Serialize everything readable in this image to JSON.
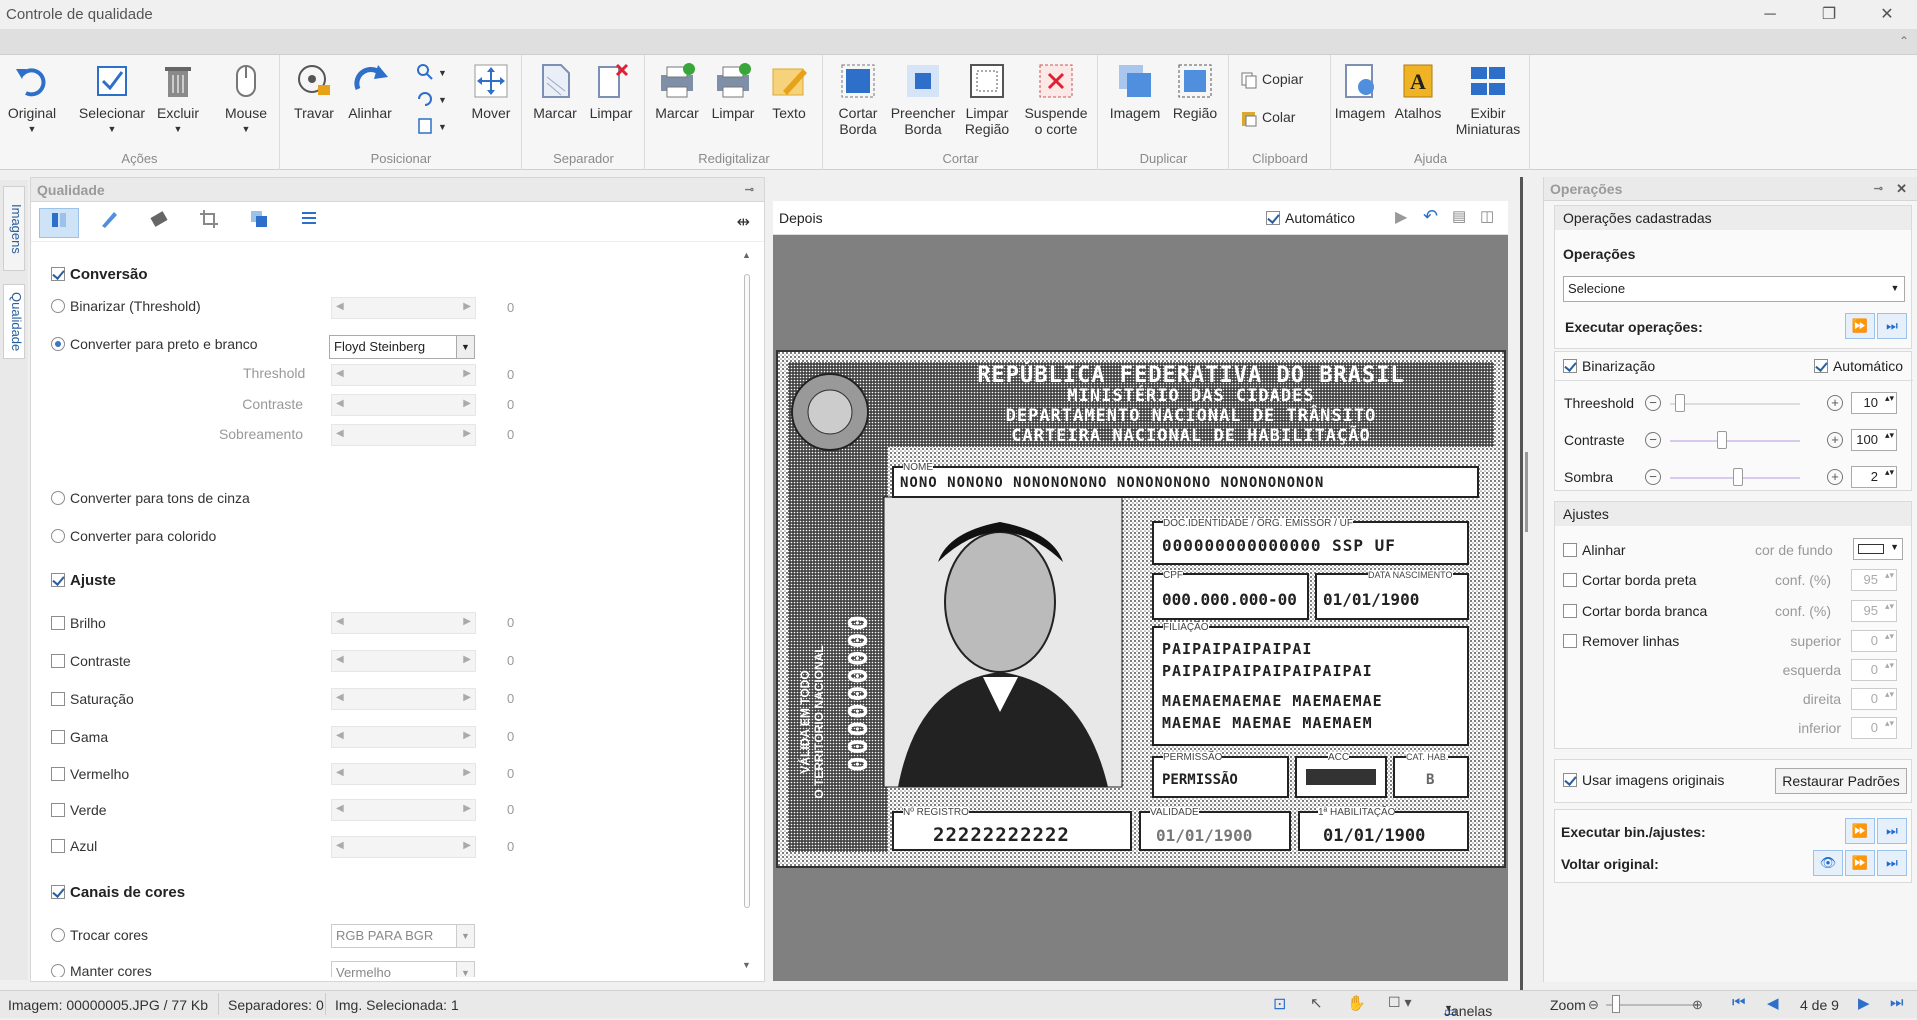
{
  "window": {
    "title": "Controle de qualidade"
  },
  "ribbon": {
    "groups": {
      "acoes": "Ações",
      "posicionar": "Posicionar",
      "separador": "Separador",
      "redigitalizar": "Redigitalizar",
      "cortar": "Cortar",
      "duplicar": "Duplicar",
      "clipboard": "Clipboard",
      "ajuda": "Ajuda"
    },
    "buttons": {
      "original": "Original",
      "selecionar": "Selecionar",
      "excluir": "Excluir",
      "mouse": "Mouse",
      "travar": "Travar",
      "alinhar": "Alinhar",
      "mover": "Mover",
      "marcar_sep": "Marcar",
      "limpar_sep": "Limpar",
      "marcar_red": "Marcar",
      "limpar_red": "Limpar",
      "texto": "Texto",
      "cortar_borda_1": "Cortar",
      "cortar_borda_2": "Borda",
      "preencher_borda_1": "Preencher",
      "preencher_borda_2": "Borda",
      "limpar_regiao_1": "Limpar",
      "limpar_regiao_2": "Região",
      "suspende_corte_1": "Suspende",
      "suspende_corte_2": "o corte",
      "imagem_dup": "Imagem",
      "regiao_dup": "Região",
      "copiar": "Copiar",
      "colar": "Colar",
      "imagem_help": "Imagem",
      "atalhos": "Atalhos",
      "exibir_1": "Exibir",
      "exibir_2": "Miniaturas"
    }
  },
  "sidetabs": {
    "imagens": "Imagens",
    "qualidade": "Qualidade"
  },
  "quality": {
    "header": "Qualidade",
    "conversao": "Conversão",
    "binarizar": "Binarizar (Threshold)",
    "preto_branco": "Converter para preto e branco",
    "dither_value": "Floyd Steinberg",
    "threshold": "Threshold",
    "contraste": "Contraste",
    "sobreamento": "Sobreamento",
    "tons_cinza": "Converter para tons de cinza",
    "colorido": "Converter para colorido",
    "ajuste": "Ajuste",
    "brilho": "Brilho",
    "contraste2": "Contraste",
    "saturacao": "Saturação",
    "gama": "Gama",
    "vermelho": "Vermelho",
    "verde": "Verde",
    "azul": "Azul",
    "canais": "Canais de cores",
    "trocar": "Trocar cores",
    "trocar_value": "RGB PARA BGR",
    "manter": "Manter cores",
    "manter_value": "Vermelho",
    "zero": "0"
  },
  "viewer": {
    "label": "Depois",
    "auto": "Automático"
  },
  "card": {
    "l1": "REPÚBLICA FEDERATIVA DO BRASIL",
    "l2": "MINISTÉRIO DAS CIDADES",
    "l3": "DEPARTAMENTO NACIONAL DE TRÂNSITO",
    "l4": "CARTEIRA NACIONAL DE HABILITAÇÃO",
    "nome_label": "NOME",
    "nome": "NONO NONONO NONONONONO NONONONONO NONONONONON",
    "doc_label": "DOC.IDENTIDADE / ÓRG. EMISSOR / UF",
    "doc": "000000000000000 SSP UF",
    "cpf_label": "CPF",
    "cpf": "000.000.000-00",
    "nasc_label": "DATA NASCIMENTO",
    "nasc": "01/01/1900",
    "filiacao_label": "FILIAÇÃO",
    "f1": "PAIPAIPAIPAIPAI",
    "f2": "PAIPAIPAIPAIPAIPAIPAI",
    "f3": "MAEMAEMAEMAE MAEMAEMAE",
    "f4": "MAEMAE MAEMAE MAEMAEM",
    "perm_label": "PERMISSÃO",
    "perm": "PERMISSÃO",
    "acc_label": "ACC",
    "cat_label": "CAT. HAB.",
    "cat": "B",
    "reg_label": "Nº REGISTRO",
    "reg": "22222222222",
    "val_label": "VALIDADE",
    "val": "01/01/1900",
    "hab_label": "1ª HABILITAÇÃO",
    "hab": "01/01/1900",
    "side1": "VÁLIDA EM TODO",
    "side2": "O TERRITÓRIO NACIONAL",
    "sidenum": "000000000"
  },
  "ops": {
    "header": "Operações",
    "cadastradas": "Operações cadastradas",
    "operacoes": "Operações",
    "selecione": "Selecione",
    "executar": "Executar operações:",
    "binarizacao": "Binarização",
    "automatico": "Automático",
    "threshold": "Threeshold",
    "threshold_val": "10",
    "contraste": "Contraste",
    "contraste_val": "100",
    "sombra": "Sombra",
    "sombra_val": "2",
    "ajustes": "Ajustes",
    "alinhar": "Alinhar",
    "cor_fundo": "cor de fundo",
    "borda_preta": "Cortar borda preta",
    "borda_branca": "Cortar borda branca",
    "conf": "conf. (%)",
    "conf_val": "95",
    "remover": "Remover linhas",
    "superior": "superior",
    "esquerda": "esquerda",
    "direita": "direita",
    "inferior": "inferior",
    "zero": "0",
    "usar_originais": "Usar imagens originais",
    "restaurar": "Restaurar Padrões",
    "exec_bin": "Executar bin./ajustes:",
    "voltar": "Voltar original:"
  },
  "status": {
    "imagem": "Imagem: 00000005.JPG / 77 Kb",
    "separadores": "Separadores: 0",
    "selecionada": "Img. Selecionada: 1",
    "janelas": "Janelas",
    "zoom": "Zoom",
    "page": "4 de 9"
  },
  "colors": {
    "accent": "#2a5f9e",
    "viewer_bg": "#808080"
  }
}
